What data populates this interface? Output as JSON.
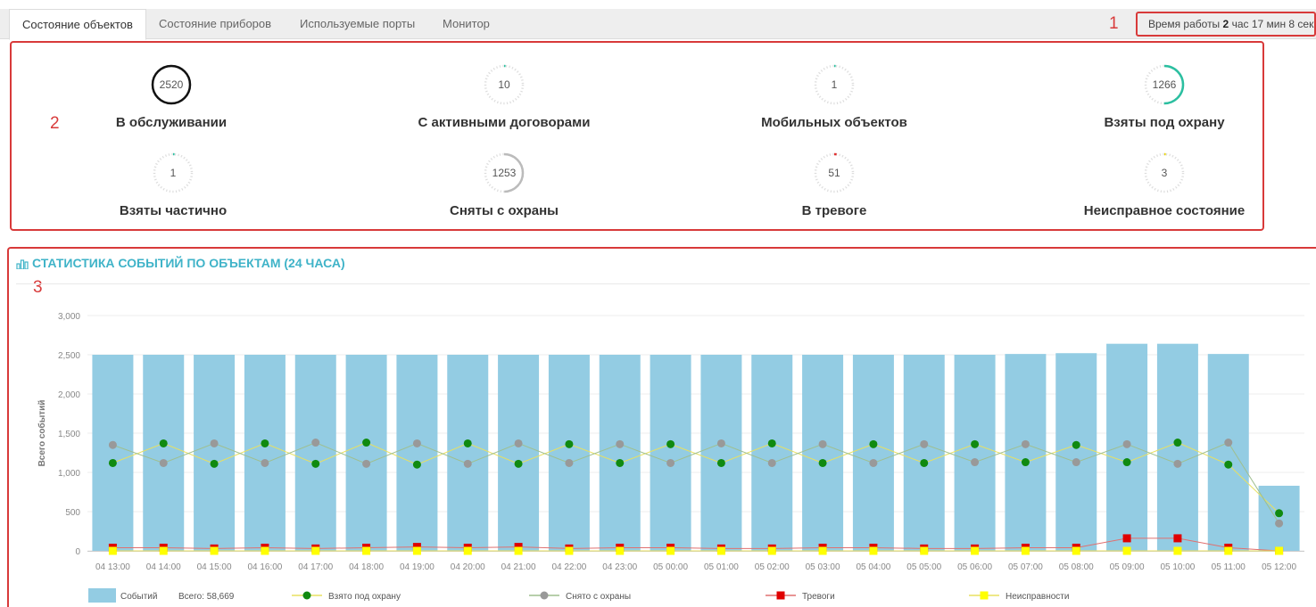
{
  "tabs": [
    {
      "label": "Состояние объектов",
      "active": true
    },
    {
      "label": "Состояние приборов",
      "active": false
    },
    {
      "label": "Используемые порты",
      "active": false
    },
    {
      "label": "Монитор",
      "active": false
    }
  ],
  "uptime": {
    "prefix": "Время работы",
    "hours": "2",
    "rest": "час 17 мин 8 сек"
  },
  "markers": {
    "m1": "1",
    "m2": "2",
    "m3": "3"
  },
  "stats": [
    {
      "value": "2520",
      "label": "В обслуживании",
      "fraction": 1.0,
      "color": "#111111"
    },
    {
      "value": "10",
      "label": "С активными договорами",
      "fraction": 0.004,
      "color": "#2bbfa0"
    },
    {
      "value": "1",
      "label": "Мобильных объектов",
      "fraction": 0.0004,
      "color": "#2bbfa0"
    },
    {
      "value": "1266",
      "label": "Взяты под охрану",
      "fraction": 0.502,
      "color": "#2bbfa0"
    },
    {
      "value": "1",
      "label": "Взяты частично",
      "fraction": 0.0004,
      "color": "#2bbfa0"
    },
    {
      "value": "1253",
      "label": "Сняты с охраны",
      "fraction": 0.497,
      "color": "#bbbbbb"
    },
    {
      "value": "51",
      "label": "В тревоге",
      "fraction": 0.02,
      "color": "#e03030"
    },
    {
      "value": "3",
      "label": "Неисправное состояние",
      "fraction": 0.0012,
      "color": "#e8d200"
    }
  ],
  "chart_title": "СТАТИСТИКА СОБЫТИЙ ПО ОБЪЕКТАМ (24 ЧАСА)",
  "colors": {
    "bars": "#93cce3",
    "armed": "#108a10",
    "disarmed": "#999999",
    "alarms": "#e00000",
    "faults": "#ffff00",
    "accent": "#3fb3c8"
  },
  "chart_data": {
    "type": "bar",
    "title": "СТАТИСТИКА СОБЫТИЙ ПО ОБЪЕКТАМ (24 ЧАСА)",
    "ylabel": "Всего событий",
    "ylim": [
      0,
      3000
    ],
    "yticks": [
      "0",
      "500",
      "1,000",
      "1,500",
      "2,000",
      "2,500",
      "3,000"
    ],
    "ytick_values": [
      0,
      500,
      1000,
      1500,
      2000,
      2500,
      3000
    ],
    "categories": [
      "04 13:00",
      "04 14:00",
      "04 15:00",
      "04 16:00",
      "04 17:00",
      "04 18:00",
      "04 19:00",
      "04 20:00",
      "04 21:00",
      "04 22:00",
      "04 23:00",
      "05 00:00",
      "05 01:00",
      "05 02:00",
      "05 03:00",
      "05 04:00",
      "05 05:00",
      "05 06:00",
      "05 07:00",
      "05 08:00",
      "05 09:00",
      "05 10:00",
      "05 11:00",
      "05 12:00"
    ],
    "series": [
      {
        "name": "Событий",
        "kind": "bar",
        "values": [
          2500,
          2500,
          2500,
          2500,
          2500,
          2500,
          2500,
          2500,
          2500,
          2500,
          2500,
          2500,
          2500,
          2500,
          2500,
          2500,
          2500,
          2500,
          2510,
          2520,
          2640,
          2640,
          2510,
          830
        ]
      },
      {
        "name": "Взято под охрану",
        "kind": "line",
        "values": [
          1120,
          1370,
          1110,
          1370,
          1110,
          1380,
          1100,
          1370,
          1110,
          1360,
          1120,
          1360,
          1120,
          1370,
          1120,
          1360,
          1120,
          1360,
          1130,
          1350,
          1130,
          1380,
          1100,
          480
        ]
      },
      {
        "name": "Снято с охраны",
        "kind": "line",
        "values": [
          1350,
          1120,
          1370,
          1120,
          1380,
          1110,
          1370,
          1110,
          1370,
          1120,
          1360,
          1120,
          1370,
          1120,
          1360,
          1120,
          1360,
          1130,
          1360,
          1130,
          1360,
          1110,
          1380,
          350
        ]
      },
      {
        "name": "Тревоги",
        "kind": "line",
        "values": [
          40,
          40,
          30,
          40,
          30,
          40,
          50,
          40,
          50,
          30,
          40,
          40,
          30,
          30,
          40,
          40,
          30,
          30,
          40,
          40,
          160,
          160,
          40,
          0
        ]
      },
      {
        "name": "Неисправности",
        "kind": "line",
        "values": [
          0,
          0,
          0,
          0,
          0,
          0,
          0,
          0,
          0,
          0,
          0,
          0,
          0,
          0,
          0,
          0,
          0,
          0,
          0,
          0,
          0,
          0,
          0,
          0
        ]
      }
    ],
    "legend": {
      "bars_label": "Событий",
      "total_label": "Всего: 58,669",
      "armed": "Взято под охрану",
      "disarmed": "Снято с охраны",
      "alarms": "Тревоги",
      "faults": "Неисправности",
      "position": "bottom"
    }
  }
}
